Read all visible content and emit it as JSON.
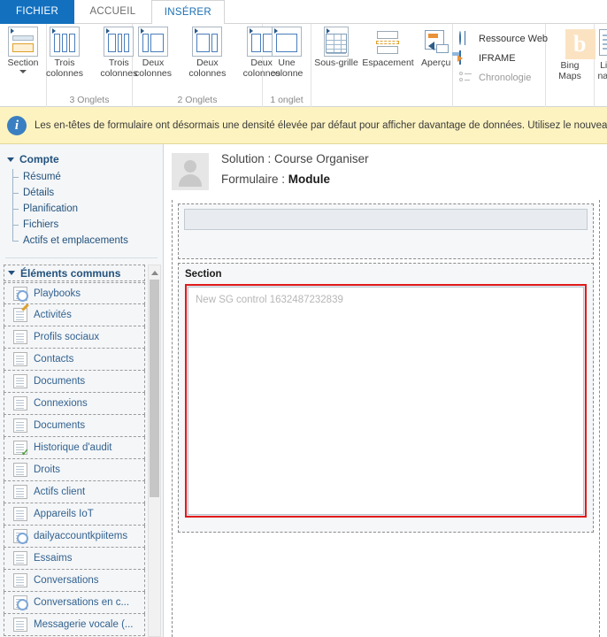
{
  "tabs": [
    {
      "label": "FICHIER",
      "kind": "file",
      "active": false
    },
    {
      "label": "ACCUEIL",
      "kind": "normal",
      "active": false
    },
    {
      "label": "INSÉRER",
      "kind": "normal",
      "active": true
    }
  ],
  "ribbon": {
    "groups": [
      {
        "label": "",
        "buttons": [
          {
            "label": "Section",
            "label2": "",
            "icon": "section-icon",
            "dropdown": true
          }
        ]
      },
      {
        "label": "3 Onglets",
        "buttons": [
          {
            "label": "Trois",
            "label2": "colonnes",
            "icon": "three-columns-equal-icon",
            "dropdown": false
          },
          {
            "label": "Trois",
            "label2": "colonnes",
            "icon": "three-columns-wide-icon",
            "dropdown": false
          }
        ]
      },
      {
        "label": "2 Onglets",
        "buttons": [
          {
            "label": "Deux",
            "label2": "colonnes",
            "icon": "two-columns-narrow-left-icon",
            "dropdown": false
          },
          {
            "label": "Deux",
            "label2": "colonnes",
            "icon": "two-columns-wide-left-icon",
            "dropdown": false
          },
          {
            "label": "Deux",
            "label2": "colonnes",
            "icon": "two-columns-equal-icon",
            "dropdown": false
          }
        ]
      },
      {
        "label": "1 onglet",
        "buttons": [
          {
            "label": "Une",
            "label2": "colonne",
            "icon": "one-column-icon",
            "dropdown": false
          }
        ]
      },
      {
        "label": "",
        "buttons": [
          {
            "label": "Sous-grille",
            "label2": "",
            "icon": "subgrid-icon",
            "dropdown": false
          },
          {
            "label": "Espacement",
            "label2": "",
            "icon": "spacer-icon",
            "dropdown": false
          },
          {
            "label": "Aperçu",
            "label2": "",
            "icon": "quick-view-icon",
            "dropdown": false
          }
        ]
      }
    ],
    "web_items": [
      {
        "label": "Ressource Web",
        "icon": "globe-icon",
        "disabled": false
      },
      {
        "label": "IFRAME",
        "icon": "iframe-icon",
        "disabled": false
      },
      {
        "label": "Chronologie",
        "icon": "timeline-icon",
        "disabled": true
      }
    ],
    "bing": {
      "label1": "Bing",
      "label2": "Maps",
      "letter": "b",
      "icon": "bing-maps-icon"
    },
    "navlink": {
      "label1": "Lien",
      "label2": "navig",
      "icon": "navigation-link-icon"
    }
  },
  "notification": {
    "icon": "info-icon",
    "text": "Les en-têtes de formulaire ont désormais une densité élevée par défaut pour afficher davantage de données. Utilisez le nouveau conce"
  },
  "sidebar": {
    "account": {
      "title": "Compte",
      "items": [
        {
          "label": "Résumé"
        },
        {
          "label": "Détails"
        },
        {
          "label": "Planification"
        },
        {
          "label": "Fichiers"
        },
        {
          "label": "Actifs et emplacements"
        }
      ]
    },
    "common": {
      "title": "Éléments communs",
      "items": [
        {
          "label": "Playbooks",
          "icon": "playbook-icon",
          "variant": "gear"
        },
        {
          "label": "Activités",
          "icon": "activities-icon",
          "variant": "pen"
        },
        {
          "label": "Profils sociaux",
          "icon": "social-profiles-icon",
          "variant": "plain"
        },
        {
          "label": "Contacts",
          "icon": "contacts-icon",
          "variant": "plain"
        },
        {
          "label": "Documents",
          "icon": "documents-icon",
          "variant": "plain"
        },
        {
          "label": "Connexions",
          "icon": "connections-icon",
          "variant": "plain"
        },
        {
          "label": "Documents",
          "icon": "documents-icon",
          "variant": "plain"
        },
        {
          "label": "Historique d'audit",
          "icon": "audit-history-icon",
          "variant": "check"
        },
        {
          "label": "Droits",
          "icon": "entitlements-icon",
          "variant": "plain"
        },
        {
          "label": "Actifs client",
          "icon": "customer-assets-icon",
          "variant": "plain"
        },
        {
          "label": "Appareils IoT",
          "icon": "iot-devices-icon",
          "variant": "plain"
        },
        {
          "label": "dailyaccountkpiitems",
          "icon": "daily-kpi-icon",
          "variant": "gear"
        },
        {
          "label": "Essaims",
          "icon": "swarms-icon",
          "variant": "plain"
        },
        {
          "label": "Conversations",
          "icon": "conversations-icon",
          "variant": "plain"
        },
        {
          "label": "Conversations en c...",
          "icon": "ongoing-conversations-icon",
          "variant": "gear"
        },
        {
          "label": "Messagerie vocale (...",
          "icon": "voicemail-icon",
          "variant": "plain"
        }
      ]
    }
  },
  "main": {
    "avatar_icon": "user-avatar-icon",
    "solution_line": "Solution : Course Organiser",
    "form_label": "Formulaire : ",
    "form_name": "Module",
    "section_title": "Section",
    "sg_control_placeholder": "New SG control 1632487232839",
    "selection_color": "#e01b1b"
  }
}
